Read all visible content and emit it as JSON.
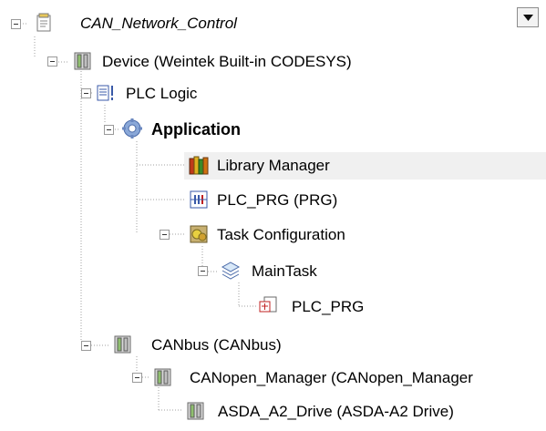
{
  "tree": {
    "nodes": [
      {
        "id": "project",
        "label": "CAN_Network_Control",
        "icon": "project-page-icon",
        "expanded": true
      },
      {
        "id": "device",
        "label": "Device (Weintek Built-in CODESYS)",
        "icon": "device-icon",
        "expanded": true
      },
      {
        "id": "plc_logic",
        "label": "PLC Logic",
        "icon": "plc-logic-icon",
        "expanded": true
      },
      {
        "id": "application",
        "label": "Application",
        "icon": "gear-icon",
        "expanded": true
      },
      {
        "id": "library_manager",
        "label": "Library Manager",
        "icon": "books-icon",
        "selected": true
      },
      {
        "id": "plc_prg",
        "label": "PLC_PRG (PRG)",
        "icon": "program-icon"
      },
      {
        "id": "task_configuration",
        "label": "Task Configuration",
        "icon": "task-config-icon",
        "expanded": true
      },
      {
        "id": "maintask",
        "label": "MainTask",
        "icon": "task-icon",
        "expanded": true
      },
      {
        "id": "plc_prg_call",
        "label": "PLC_PRG",
        "icon": "program-call-icon"
      },
      {
        "id": "canbus",
        "label": "CANbus (CANbus)",
        "icon": "device-icon",
        "expanded": true
      },
      {
        "id": "canopen_manager",
        "label": "CANopen_Manager (CANopen_Manager",
        "icon": "device-icon",
        "expanded": true
      },
      {
        "id": "asda",
        "label": "ASDA_A2_Drive (ASDA-A2 Drive)",
        "icon": "device-icon"
      }
    ]
  },
  "dropdown": {
    "icon": "triangle-down-icon"
  }
}
